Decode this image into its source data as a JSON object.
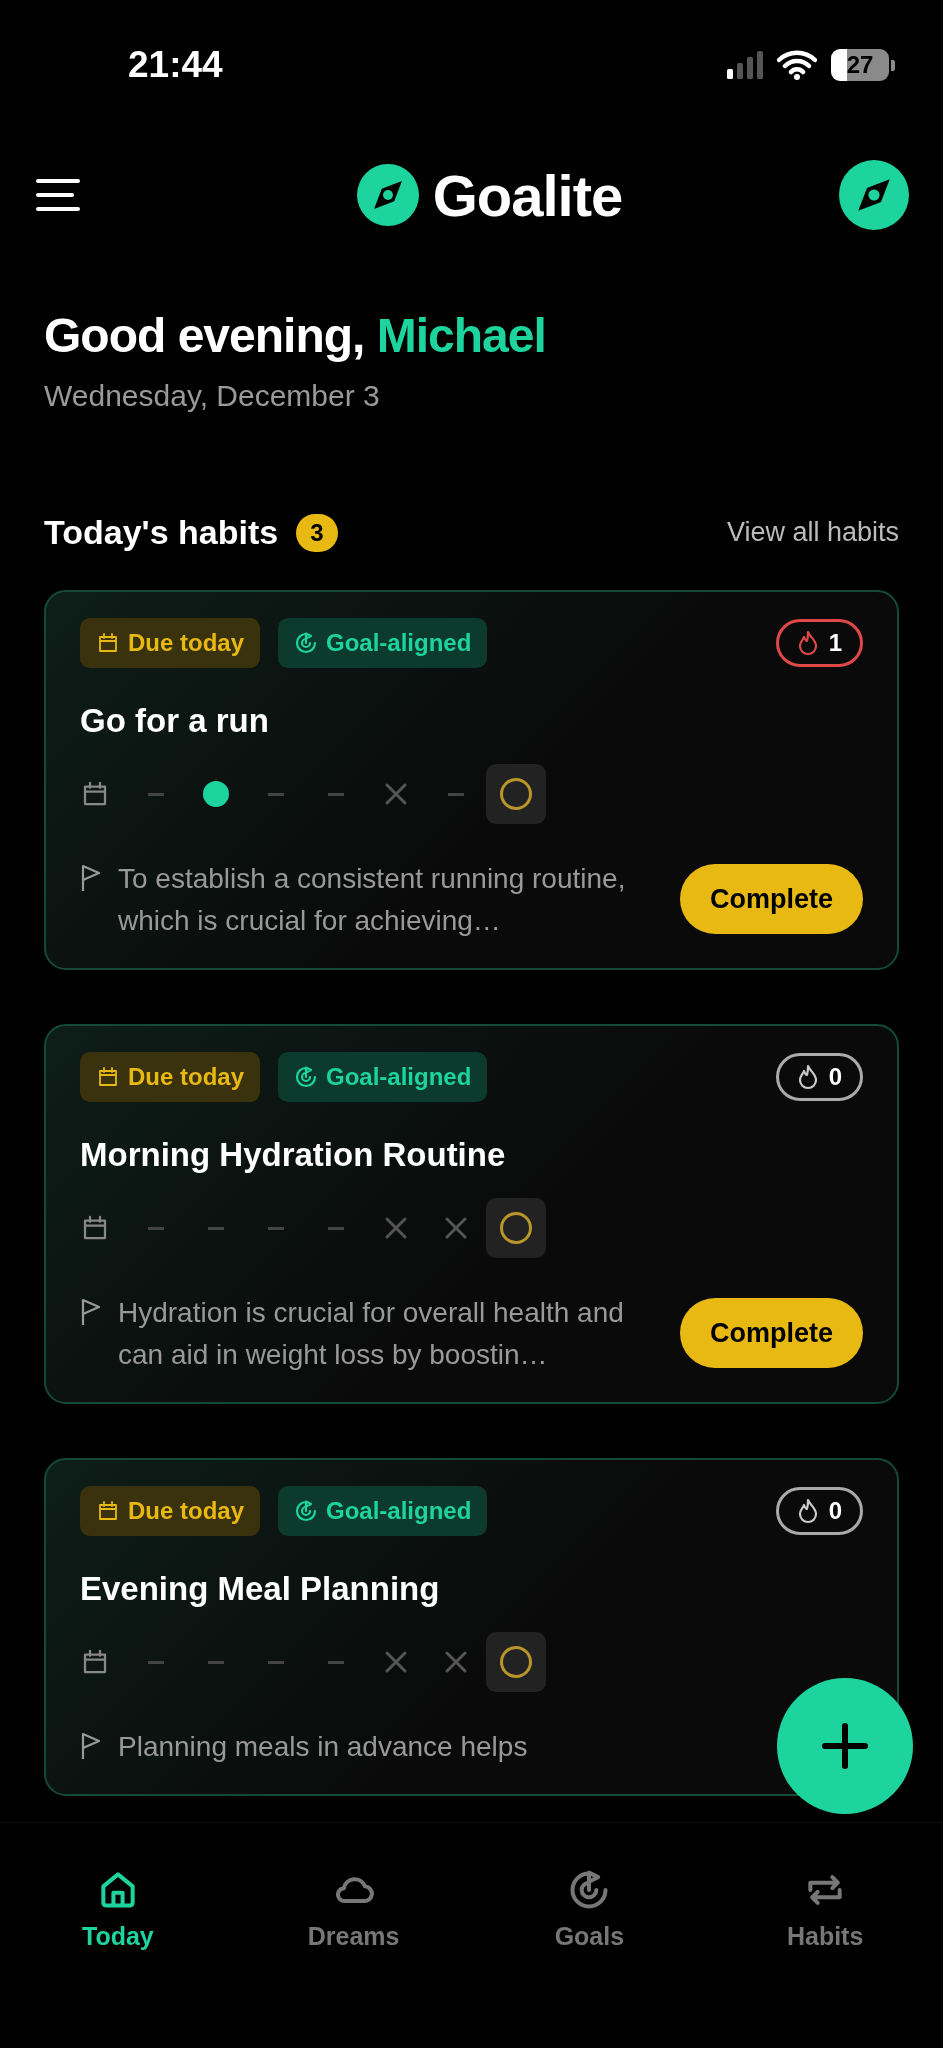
{
  "status_bar": {
    "time": "21:44",
    "battery": "27"
  },
  "header": {
    "title": "Goalite"
  },
  "greeting": {
    "text": "Good evening,",
    "name": "Michael",
    "date": "Wednesday, December 3"
  },
  "section": {
    "title": "Today's habits",
    "count": "3",
    "link": "View all habits"
  },
  "habits": [
    {
      "due": "Due today",
      "tag": "Goal-aligned",
      "streak": "1",
      "hot": true,
      "title": "Go for a run",
      "days": [
        {
          "kind": "dash"
        },
        {
          "kind": "dot"
        },
        {
          "kind": "dash"
        },
        {
          "kind": "dash"
        },
        {
          "kind": "cross"
        },
        {
          "kind": "dash"
        },
        {
          "kind": "pending"
        }
      ],
      "description": "To establish a consistent running routine, which is crucial for achieving…",
      "button": "Complete"
    },
    {
      "due": "Due today",
      "tag": "Goal-aligned",
      "streak": "0",
      "hot": false,
      "title": "Morning Hydration Routine",
      "days": [
        {
          "kind": "dash"
        },
        {
          "kind": "dash"
        },
        {
          "kind": "dash"
        },
        {
          "kind": "dash"
        },
        {
          "kind": "cross"
        },
        {
          "kind": "cross"
        },
        {
          "kind": "pending"
        }
      ],
      "description": "Hydration is crucial for overall health and can aid in weight loss by boostin…",
      "button": "Complete"
    },
    {
      "due": "Due today",
      "tag": "Goal-aligned",
      "streak": "0",
      "hot": false,
      "title": "Evening Meal Planning",
      "days": [
        {
          "kind": "dash"
        },
        {
          "kind": "dash"
        },
        {
          "kind": "dash"
        },
        {
          "kind": "dash"
        },
        {
          "kind": "cross"
        },
        {
          "kind": "cross"
        },
        {
          "kind": "pending"
        }
      ],
      "description": "Planning meals in advance helps"
    }
  ],
  "nav": [
    {
      "label": "Today",
      "kind": "home",
      "selected": true
    },
    {
      "label": "Dreams",
      "kind": "cloud",
      "selected": false
    },
    {
      "label": "Goals",
      "kind": "target",
      "selected": false
    },
    {
      "label": "Habits",
      "kind": "repeat",
      "selected": false
    }
  ]
}
